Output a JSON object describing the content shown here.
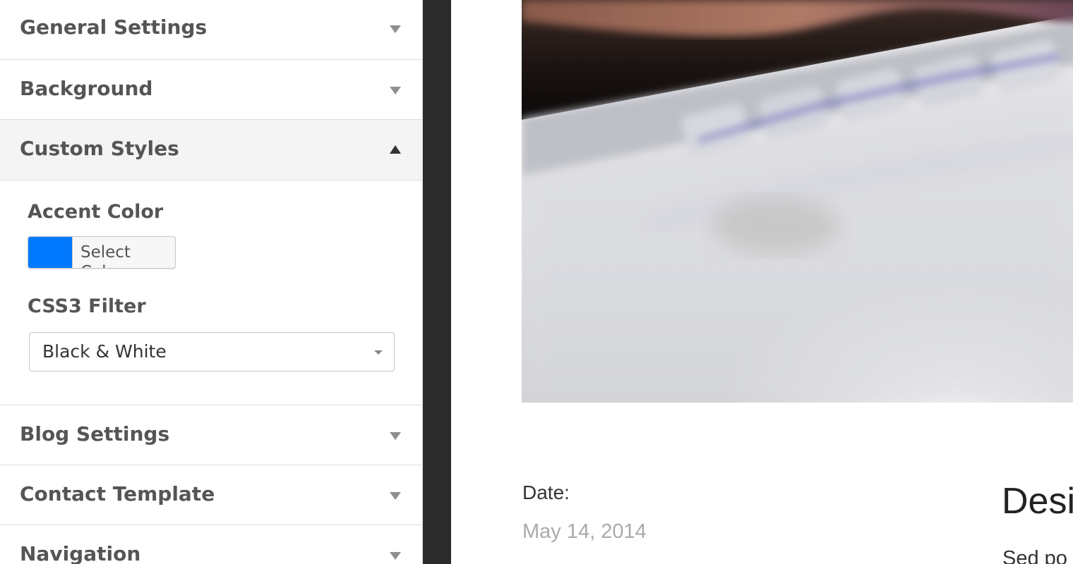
{
  "sidebar": {
    "sections": [
      {
        "title": "General Settings",
        "expanded": false
      },
      {
        "title": "Background",
        "expanded": false
      },
      {
        "title": "Custom Styles",
        "expanded": true
      },
      {
        "title": "Blog Settings",
        "expanded": false
      },
      {
        "title": "Contact Template",
        "expanded": false
      },
      {
        "title": "Navigation",
        "expanded": false
      }
    ],
    "custom_styles": {
      "accent_color_label": "Accent Color",
      "accent_color_value": "#0079ff",
      "select_color_label": "Select Color",
      "filter_label": "CSS3 Filter",
      "filter_value": "Black & White"
    }
  },
  "preview": {
    "date_label": "Date:",
    "date_value": "May 14, 2014",
    "post_title": "Desi",
    "post_excerpt": "Sed po"
  },
  "colors": {
    "accent": "#0079ff",
    "divider": "#2b2b2b",
    "section_text": "#555555"
  },
  "icons": {
    "collapsed": "caret-down-icon",
    "expanded": "caret-up-icon",
    "select": "dropdown-arrow-icon"
  }
}
